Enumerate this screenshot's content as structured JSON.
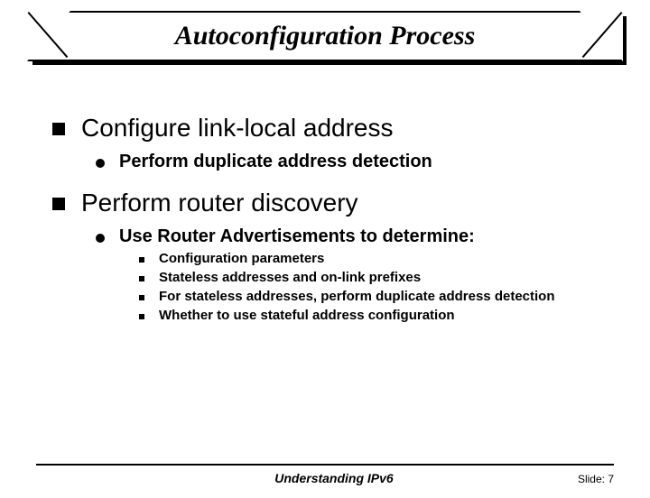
{
  "title": "Autoconfiguration Process",
  "bullets": {
    "b1": "Configure link-local address",
    "b1_1": "Perform duplicate address detection",
    "b2": "Perform router discovery",
    "b2_1": "Use Router Advertisements to determine:",
    "b2_1_1": "Configuration parameters",
    "b2_1_2": "Stateless addresses and on-link prefixes",
    "b2_1_3": "For stateless addresses, perform duplicate address detection",
    "b2_1_4": "Whether to use stateful address configuration"
  },
  "footer": {
    "center": "Understanding IPv6",
    "right": "Slide: 7"
  }
}
